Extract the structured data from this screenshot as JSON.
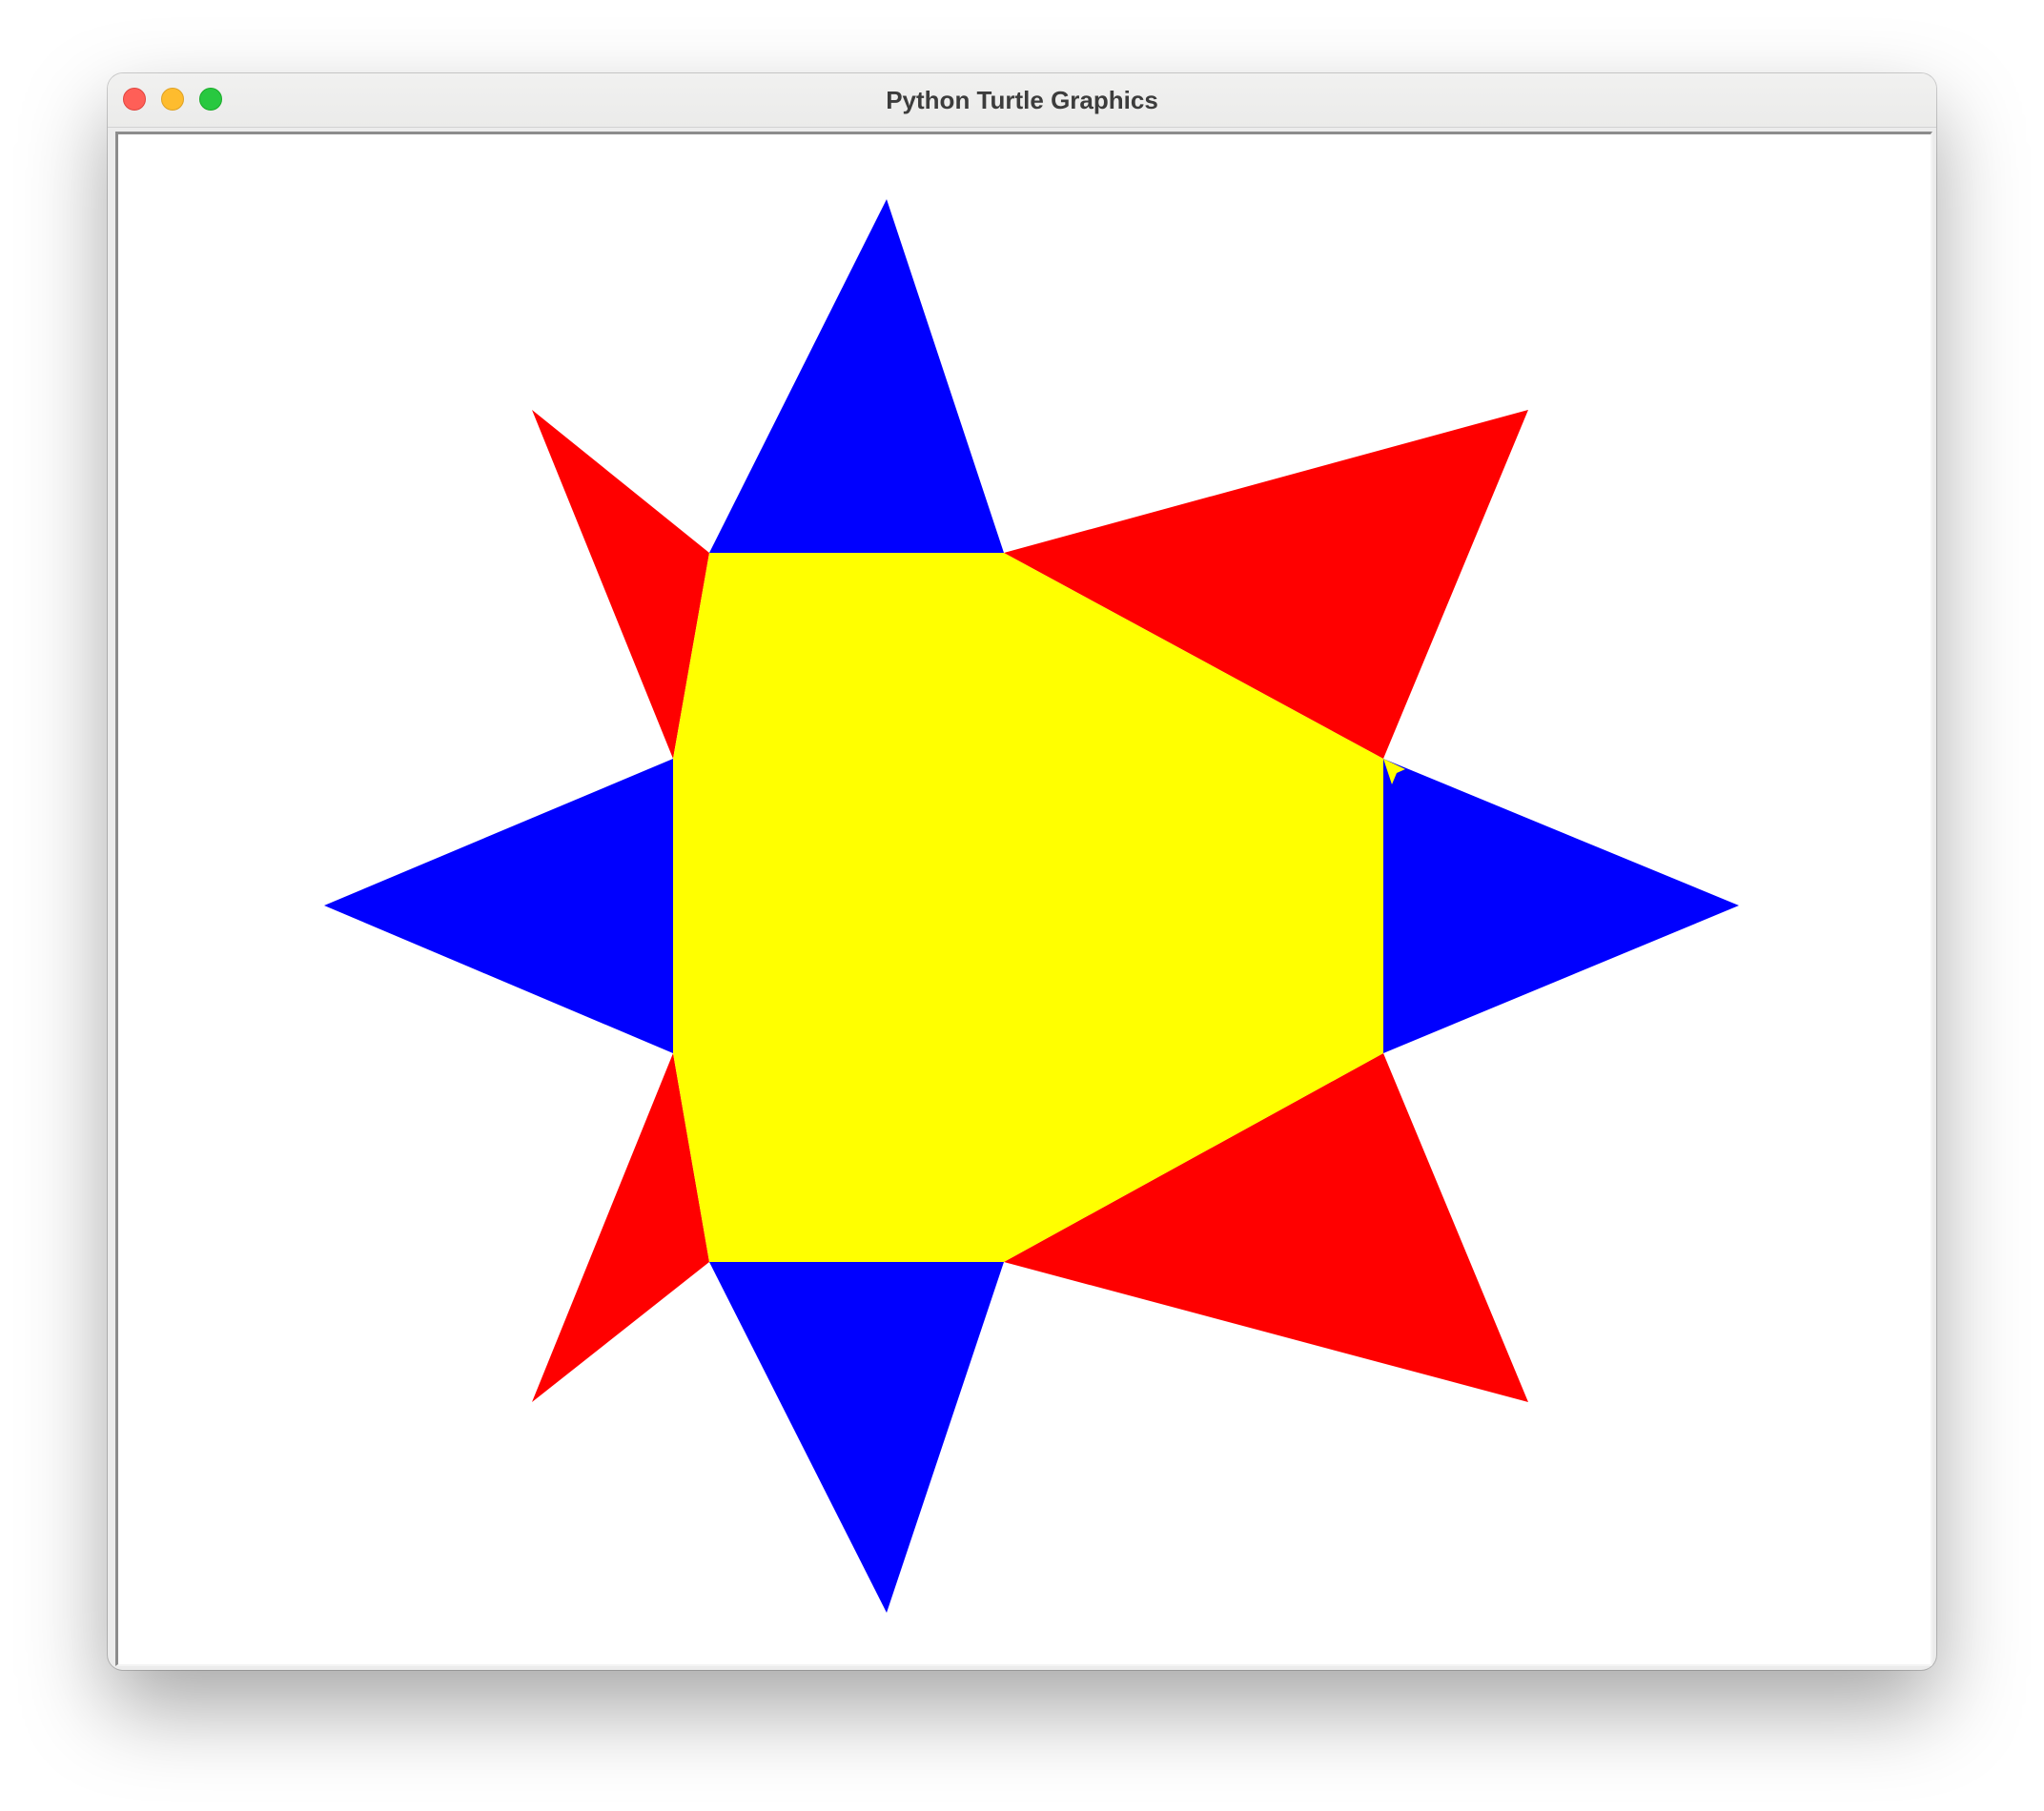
{
  "window": {
    "title": "Python Turtle Graphics"
  },
  "controls": {
    "close": "close-icon",
    "minimize": "minimize-icon",
    "zoom": "zoom-icon"
  },
  "colors": {
    "octagon": "#ffff00",
    "star_points_cardinal": "#0000ff",
    "star_points_diagonal": "#ff0000",
    "canvas_background": "#ffffff"
  }
}
